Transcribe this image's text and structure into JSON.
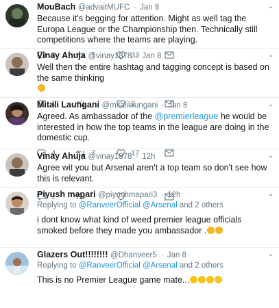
{
  "tweets": [
    {
      "name": "MouBach",
      "handle": "@advaitMUFC",
      "time": "Jan 8",
      "text": "Because it's begging for attention. Might as well tag the Europa League or the Championship then. Technically still competitions where the teams are playing.",
      "replies": "3",
      "retweets": "1",
      "likes": "33"
    },
    {
      "name": "Vinay Ahuja",
      "handle": "@vinay1878",
      "time": "Jan 8",
      "text": "Well then the entire hashtag and tagging concept is based on the same thinking",
      "replies": "1",
      "retweets": "",
      "likes": "2"
    },
    {
      "name": "Mitali Laungani",
      "handle": "@mitalilaungani",
      "time": "Jan 8",
      "text_before": "Agreed. As ambassador of the ",
      "mention": "@premierleague",
      "text_after": " he would be interested in how the top teams in the league are doing in the domestic cup.",
      "replies": "4",
      "retweets": "7",
      "likes": "17"
    },
    {
      "name": "Vinay Ahuja",
      "handle": "@vinay1878",
      "time": "12h",
      "text": "Agree wit you but Arsenal aren't a top team so don't see how this is relevant.",
      "replies": "1",
      "retweets": "",
      "likes": ""
    },
    {
      "name": "Piyush mapari",
      "handle": "@piyushmapari3",
      "time": "12h",
      "reply_prefix": "Replying to ",
      "reply_to": "@RanveerOfficial @Arsenal",
      "reply_suffix": " and 2 others",
      "text": "i dont know what kind of weed premier league officials smoked before they made you ambassador ."
    },
    {
      "name": "Glazers Out!!!!!!!!",
      "handle": "@Dhanveer5",
      "time": "Jan 8",
      "reply_prefix": "Replying to ",
      "reply_to": "@RanveerOfficial @Arsenal",
      "reply_suffix": " and 2 others",
      "text": "This is no Premier League game mate..."
    }
  ],
  "colors": {
    "link": "#1b95e0",
    "muted": "#657786",
    "divider": "#e6ecf0"
  }
}
